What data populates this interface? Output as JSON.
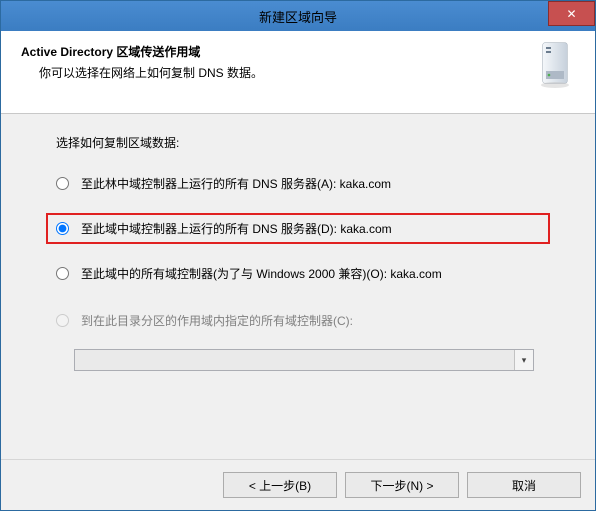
{
  "window": {
    "title": "新建区域向导"
  },
  "header": {
    "title": "Active Directory 区域传送作用域",
    "subtitle": "你可以选择在网络上如何复制 DNS 数据。"
  },
  "body": {
    "prompt": "选择如何复制区域数据:",
    "options": [
      {
        "label": "至此林中域控制器上运行的所有 DNS 服务器(A): kaka.com",
        "selected": false,
        "disabled": false,
        "highlight": false
      },
      {
        "label": "至此域中域控制器上运行的所有 DNS 服务器(D): kaka.com",
        "selected": true,
        "disabled": false,
        "highlight": true
      },
      {
        "label": "至此域中的所有域控制器(为了与 Windows 2000 兼容)(O): kaka.com",
        "selected": false,
        "disabled": false,
        "highlight": false
      },
      {
        "label": "到在此目录分区的作用域内指定的所有域控制器(C):",
        "selected": false,
        "disabled": true,
        "highlight": false
      }
    ],
    "combo_value": ""
  },
  "footer": {
    "back": "< 上一步(B)",
    "next": "下一步(N) >",
    "cancel": "取消"
  }
}
